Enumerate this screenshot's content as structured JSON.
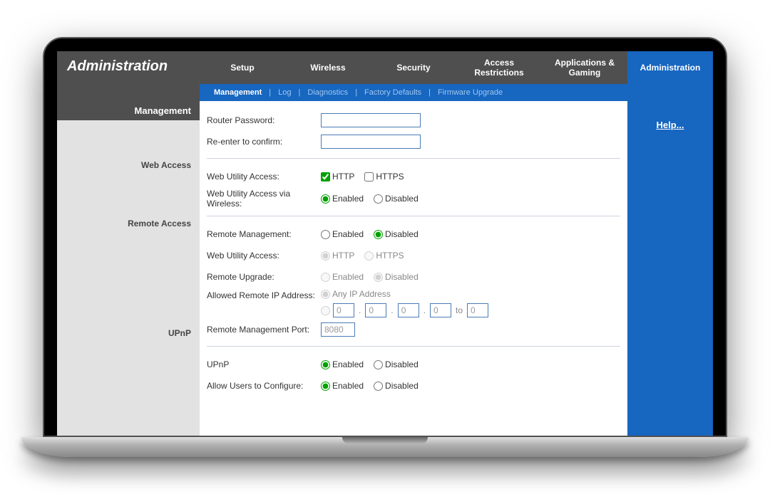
{
  "header": {
    "title": "Administration",
    "tabs": {
      "setup": "Setup",
      "wireless": "Wireless",
      "security": "Security",
      "access": "Access Restrictions",
      "apps": "Applications & Gaming",
      "admin": "Administration"
    },
    "subnav": {
      "management": "Management",
      "log": "Log",
      "diagnostics": "Diagnostics",
      "factory": "Factory Defaults",
      "firmware": "Firmware Upgrade"
    }
  },
  "sidebar": {
    "section": "Management",
    "web_access": "Web Access",
    "remote_access": "Remote Access",
    "upnp": "UPnP"
  },
  "help": "Help...",
  "labels": {
    "router_password": "Router Password:",
    "reenter": "Re-enter to  confirm:",
    "web_utility_access": "Web Utility Access:",
    "http": "HTTP",
    "https": "HTTPS",
    "web_utility_access_wireless": "Web Utility Access via Wireless:",
    "enabled": "Enabled",
    "disabled": "Disabled",
    "remote_management": "Remote  Management:",
    "remote_upgrade": "Remote Upgrade:",
    "allowed_remote_ip": "Allowed Remote IP Address:",
    "any_ip": "Any IP Address",
    "remote_port": "Remote Management Port:",
    "upnp": "UPnP",
    "allow_users": "Allow Users to Configure:",
    "to": "to"
  },
  "values": {
    "router_password": "",
    "reenter": "",
    "http_checked": true,
    "https_checked": false,
    "wireless_access": "enabled",
    "remote_management": "disabled",
    "remote_web_access": "http",
    "remote_upgrade": "disabled",
    "allowed_ip_mode": "any",
    "ip_oct1": "0",
    "ip_oct2": "0",
    "ip_oct3": "0",
    "ip_oct4": "0",
    "ip_to": "0",
    "remote_port": "8080",
    "upnp": "enabled",
    "allow_users": "enabled"
  }
}
